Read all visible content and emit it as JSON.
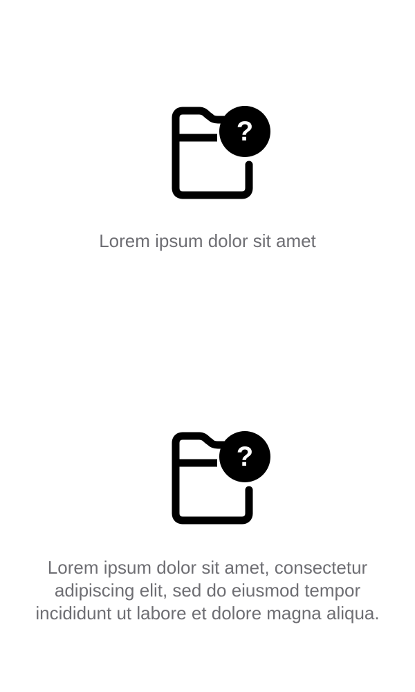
{
  "empty_states": [
    {
      "icon": "folder-question-icon",
      "message": "Lorem ipsum dolor sit amet"
    },
    {
      "icon": "folder-question-icon",
      "message": "Lorem ipsum dolor sit amet, consectetur adipiscing elit, sed do eiusmod tempor incididunt ut labore et dolore magna aliqua."
    }
  ],
  "colors": {
    "icon": "#000000",
    "text": "#6e6e73",
    "background": "#ffffff"
  }
}
